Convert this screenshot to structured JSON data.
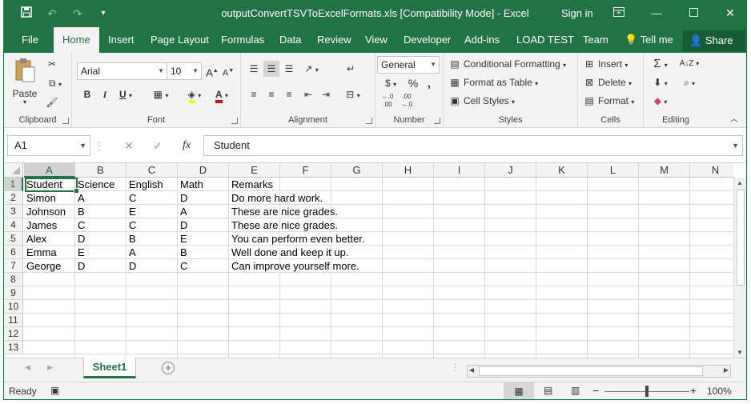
{
  "window": {
    "title": "outputConvertTSVToExcelFormats.xls  [Compatibility Mode] - Excel",
    "signin": "Sign in",
    "save_icon": "save-icon",
    "undo_icon": "undo-icon",
    "redo_icon": "redo-icon"
  },
  "tabs": [
    "File",
    "Home",
    "Insert",
    "Page Layout",
    "Formulas",
    "Data",
    "Review",
    "View",
    "Developer",
    "Add-ins",
    "LOAD TEST",
    "Team",
    "Tell me",
    "Share"
  ],
  "ribbon": {
    "clipboard": {
      "paste": "Paste",
      "label": "Clipboard"
    },
    "font": {
      "name": "Arial",
      "size": "10",
      "bold": "B",
      "italic": "I",
      "underline": "U",
      "label": "Font"
    },
    "alignment": {
      "label": "Alignment"
    },
    "number": {
      "format": "General",
      "currency": "$",
      "percent": "%",
      "comma": ",",
      "label": "Number"
    },
    "styles": {
      "conditional": "Conditional Formatting",
      "table": "Format as Table",
      "cell": "Cell Styles",
      "label": "Styles"
    },
    "cells": {
      "insert": "Insert",
      "delete": "Delete",
      "format": "Format",
      "label": "Cells"
    },
    "editing": {
      "label": "Editing"
    }
  },
  "formula_bar": {
    "name_box": "A1",
    "fx": "fx",
    "value": "Student"
  },
  "columns": [
    "A",
    "B",
    "C",
    "D",
    "E",
    "F",
    "G",
    "H",
    "I",
    "J",
    "K",
    "L",
    "M",
    "N"
  ],
  "rows": [
    "1",
    "2",
    "3",
    "4",
    "5",
    "6",
    "7",
    "8",
    "9",
    "10",
    "11",
    "12",
    "13"
  ],
  "cells": [
    [
      "Student",
      "Science",
      "English",
      "Math",
      "Remarks"
    ],
    [
      "Simon",
      "A",
      "C",
      "D",
      "Do more hard work."
    ],
    [
      "Johnson",
      "B",
      "E",
      "A",
      "These are nice grades."
    ],
    [
      "James",
      "C",
      "C",
      "D",
      "These are nice grades."
    ],
    [
      "Alex",
      "D",
      "B",
      "E",
      "You can perform even better."
    ],
    [
      "Emma",
      "E",
      "A",
      "B",
      "Well done and keep it up."
    ],
    [
      "George",
      "D",
      "D",
      "C",
      "Can improve yourself more."
    ]
  ],
  "sheet_tab": "Sheet1",
  "status": {
    "ready": "Ready",
    "zoom": "100%"
  },
  "colors": {
    "accent": "#217346"
  }
}
